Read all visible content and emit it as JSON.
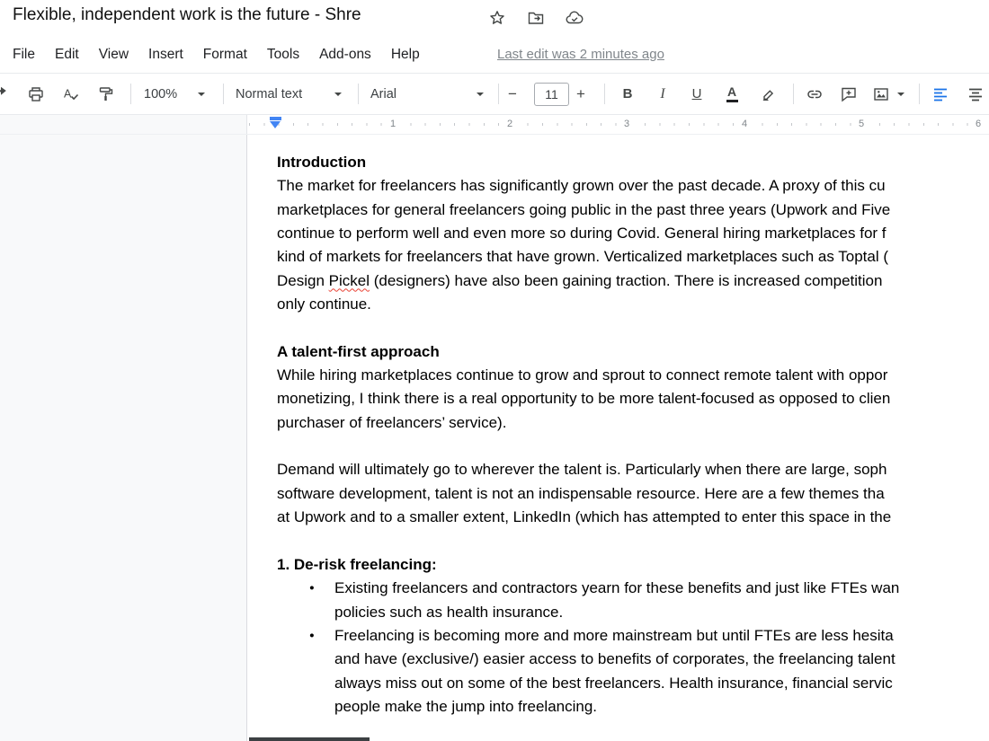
{
  "header": {
    "title": "Flexible, independent work is the future - Shre"
  },
  "menubar": {
    "items": [
      "File",
      "Edit",
      "View",
      "Insert",
      "Format",
      "Tools",
      "Add-ons",
      "Help"
    ],
    "last_edit": "Last edit was 2 minutes ago"
  },
  "toolbar": {
    "zoom": "100%",
    "style": "Normal text",
    "font": "Arial",
    "size": "11",
    "minus": "−",
    "plus": "+",
    "bold": "B",
    "italic": "I",
    "underline": "U",
    "text_color": "A"
  },
  "ruler": {
    "labels": [
      "1",
      "2",
      "3",
      "4",
      "5",
      "6"
    ]
  },
  "doc": {
    "bullet": "●",
    "heading_intro": "Introduction",
    "p1": {
      "l1": "The market for freelancers has significantly grown over the past decade. A proxy of this cu",
      "l2": "marketplaces for general freelancers going public in the past three years (Upwork and Five",
      "l3": "continue to perform well and even more so during Covid. General hiring marketplaces for f",
      "l4": "kind of markets for freelancers that have grown. Verticalized marketplaces such as Toptal (",
      "l5_pre": "Design ",
      "l5_word": "Pickel",
      "l5_post": " (designers) have also been gaining traction. There is increased competition",
      "l6": "only continue."
    },
    "heading_talent": "A talent-first approach",
    "p2": {
      "l1": "While hiring marketplaces continue to grow and sprout to connect remote talent with oppor",
      "l2": "monetizing, I think there is a real opportunity to be more talent-focused as opposed to clien",
      "l3": "purchaser of freelancers’ service)."
    },
    "p3": {
      "l1": "Demand will ultimately go to wherever the talent is. Particularly when there are large, soph",
      "l2": "software development, talent is not an indispensable resource. Here are a few themes tha",
      "l3": "at Upwork and to a smaller extent, LinkedIn (which has attempted to enter this space in the"
    },
    "heading_derisk": "1. De-risk freelancing:",
    "b1": {
      "l1": "Existing freelancers and contractors yearn for these benefits and just like FTEs wan",
      "l2": "policies such as health insurance."
    },
    "b2": {
      "l1": "Freelancing is becoming more and more mainstream but until FTEs are less hesita",
      "l2": "and have (exclusive/) easier access to benefits of corporates, the freelancing talent",
      "l3": "always miss out on some of the best freelancers. Health insurance, financial servic",
      "l4": "people make the jump into freelancing."
    }
  }
}
